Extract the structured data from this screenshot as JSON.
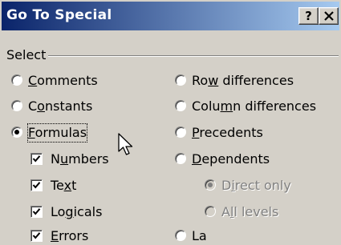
{
  "dialog": {
    "title": "Go To Special",
    "help_label": "?",
    "close_label": "✕",
    "select_group_label": "Select"
  },
  "left_options": [
    {
      "label_pre": "",
      "mnemonic": "C",
      "label_post": "omments",
      "checked": false
    },
    {
      "label_pre": "C",
      "mnemonic": "o",
      "label_post": "nstants",
      "checked": false
    },
    {
      "label_pre": "",
      "mnemonic": "F",
      "label_post": "ormulas",
      "checked": true
    }
  ],
  "formula_types": [
    {
      "label_pre": "N",
      "mnemonic": "u",
      "label_post": "mbers",
      "checked": true
    },
    {
      "label_pre": "Te",
      "mnemonic": "x",
      "label_post": "t",
      "checked": true
    },
    {
      "label_pre": "Lo",
      "mnemonic": "g",
      "label_post": "icals",
      "checked": true
    },
    {
      "label_pre": "",
      "mnemonic": "E",
      "label_post": "rrors",
      "checked": true
    }
  ],
  "right_options": [
    {
      "label_pre": "Ro",
      "mnemonic": "w",
      "label_post": " differences",
      "checked": false
    },
    {
      "label_pre": "Colu",
      "mnemonic": "m",
      "label_post": "n differences",
      "checked": false
    },
    {
      "label_pre": "",
      "mnemonic": "P",
      "label_post": "recedents",
      "checked": false
    },
    {
      "label_pre": "",
      "mnemonic": "D",
      "label_post": "ependents",
      "checked": false
    }
  ],
  "dependent_scope": [
    {
      "label_pre": "D",
      "mnemonic": "i",
      "label_post": "rect only",
      "checked": true,
      "disabled": true
    },
    {
      "label_pre": "A",
      "mnemonic": "l",
      "label_post": "l levels",
      "checked": false,
      "disabled": true
    }
  ],
  "partial_bottom": {
    "left": "",
    "right": "La"
  }
}
